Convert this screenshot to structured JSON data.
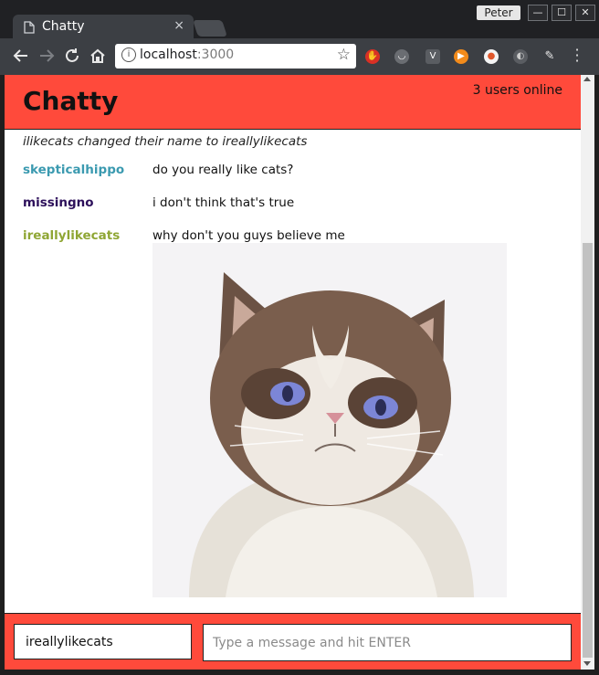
{
  "browser": {
    "tab_title": "Chatty",
    "tab_close": "×",
    "profile_name": "Peter",
    "window_controls": [
      "—",
      "☐",
      "✕"
    ],
    "url_host": "localhost",
    "url_port": ":3000",
    "nav_icons": [
      "back-icon",
      "forward-icon",
      "reload-icon",
      "home-icon"
    ],
    "extensions": [
      "adblock-icon",
      "cat-icon",
      "vim-icon",
      "play-icon",
      "egg-icon",
      "moon-icon",
      "syringe-icon"
    ]
  },
  "header": {
    "brand": "Chatty",
    "users_online": "3 users online"
  },
  "system_message": "ilikecats changed their name to ireallylikecats",
  "messages": [
    {
      "username": "skepticalhippo",
      "color": "#3b9ab0",
      "text": "do you really like cats?"
    },
    {
      "username": "missingno",
      "color": "#2c0f5a",
      "text": "i don't think that's true"
    },
    {
      "username": "ireallylikecats",
      "color": "#8fa634",
      "text": "why don't you guys believe me"
    }
  ],
  "composer": {
    "username_value": "ireallylikecats",
    "message_placeholder": "Type a message and hit ENTER"
  }
}
